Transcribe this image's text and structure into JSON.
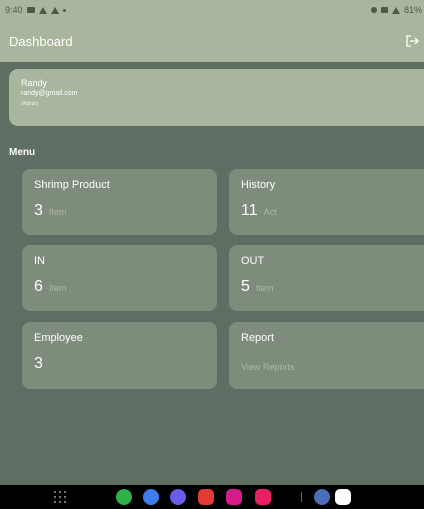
{
  "status_bar": {
    "time": "9:40",
    "battery": "81%"
  },
  "appbar": {
    "title": "Dashboard",
    "logout_icon": "logout-icon"
  },
  "profile": {
    "name": "Randy",
    "email": "randy@gmail.com",
    "role": "(Admin)"
  },
  "menu_label": "Menu",
  "cards": {
    "shrimp": {
      "title": "Shrimp Product",
      "value": "3",
      "unit": "Item"
    },
    "history": {
      "title": "History",
      "value": "11",
      "unit": "Act"
    },
    "in": {
      "title": "IN",
      "value": "6",
      "unit": "Item"
    },
    "out": {
      "title": "OUT",
      "value": "5",
      "unit": "Item"
    },
    "employee": {
      "title": "Employee",
      "value": "3"
    },
    "report": {
      "title": "Report",
      "link": "View Reports"
    }
  },
  "dock": {
    "apps": [
      "phone-icon",
      "messages-icon",
      "browser-icon",
      "flipboard-icon",
      "flower-icon",
      "screen-recorder-icon",
      "settings-icon",
      "gmail-icon"
    ]
  },
  "colors": {
    "background": "#5f6e63",
    "bar": "#a8b69e",
    "card": "#7d8c7b"
  }
}
